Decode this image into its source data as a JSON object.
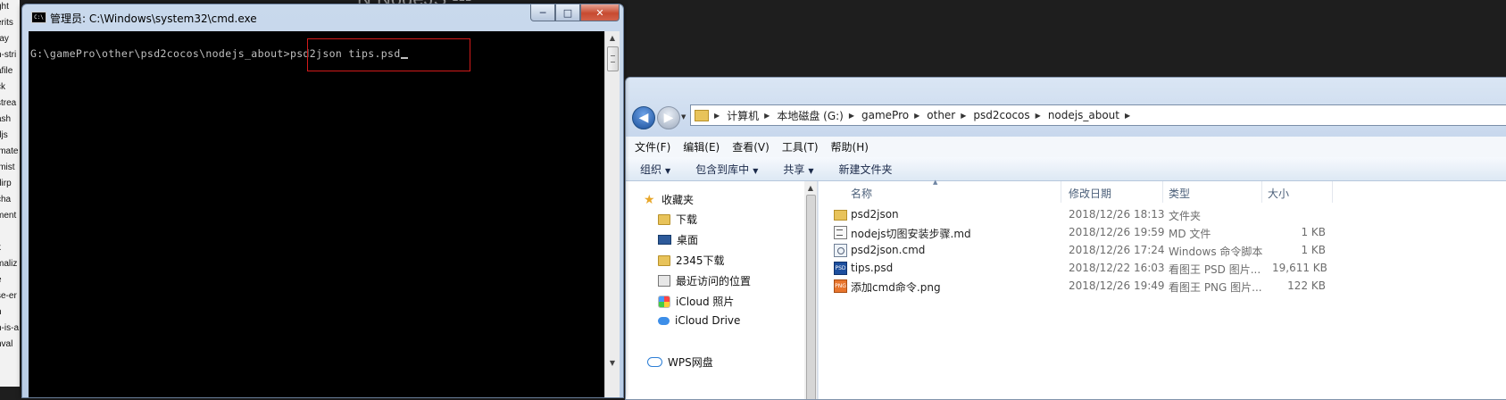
{
  "background": {
    "sidebar_items": [
      "ght",
      "erits",
      "ray",
      "n-stri",
      "afile",
      "ck",
      "strea",
      "ash",
      "djs",
      "imate",
      "imist",
      "dirp",
      "cha",
      "ment",
      "",
      "k",
      "maliz",
      "e",
      "se-er",
      "n",
      "n-is-a",
      "nval"
    ],
    "title_fragment": "N NodeJS ---"
  },
  "cmd": {
    "title": "管理员: C:\\Windows\\system32\\cmd.exe",
    "icon_text": "C:\\",
    "prompt": "G:\\gamePro\\other\\psd2cocos\\nodejs_about>",
    "command": "psd2json tips.psd",
    "highlight_color": "#d11a1a"
  },
  "explorer": {
    "breadcrumbs": [
      "计算机",
      "本地磁盘 (G:)",
      "gamePro",
      "other",
      "psd2cocos",
      "nodejs_about"
    ],
    "menu": [
      "文件(F)",
      "编辑(E)",
      "查看(V)",
      "工具(T)",
      "帮助(H)"
    ],
    "toolbar": {
      "organize": "组织",
      "include_in_library": "包含到库中",
      "share": "共享",
      "new_folder": "新建文件夹"
    },
    "nav": {
      "favorites": "收藏夹",
      "downloads": "下载",
      "desktop": "桌面",
      "downloads_2345": "2345下载",
      "recent_places": "最近访问的位置",
      "icloud_photos": "iCloud 照片",
      "icloud_drive": "iCloud Drive",
      "wps_cloud": "WPS网盘"
    },
    "columns": {
      "name": "名称",
      "modified": "修改日期",
      "type": "类型",
      "size": "大小"
    },
    "files": [
      {
        "name": "psd2json",
        "modified": "2018/12/26 18:13",
        "type": "文件夹",
        "size": "",
        "icon": "folder-icon"
      },
      {
        "name": "nodejs切图安装步骤.md",
        "modified": "2018/12/26 19:59",
        "type": "MD 文件",
        "size": "1 KB",
        "icon": "md-file-icon"
      },
      {
        "name": "psd2json.cmd",
        "modified": "2018/12/26 17:24",
        "type": "Windows 命令脚本",
        "size": "1 KB",
        "icon": "cmd-file-icon"
      },
      {
        "name": "tips.psd",
        "modified": "2018/12/22 16:03",
        "type": "看图王 PSD 图片...",
        "size": "19,611 KB",
        "icon": "psd-file-icon"
      },
      {
        "name": "添加cmd命令.png",
        "modified": "2018/12/26 19:49",
        "type": "看图王 PNG 图片...",
        "size": "122 KB",
        "icon": "png-file-icon"
      }
    ],
    "psd_icon_text": "PSD",
    "png_icon_text": "PNG"
  }
}
